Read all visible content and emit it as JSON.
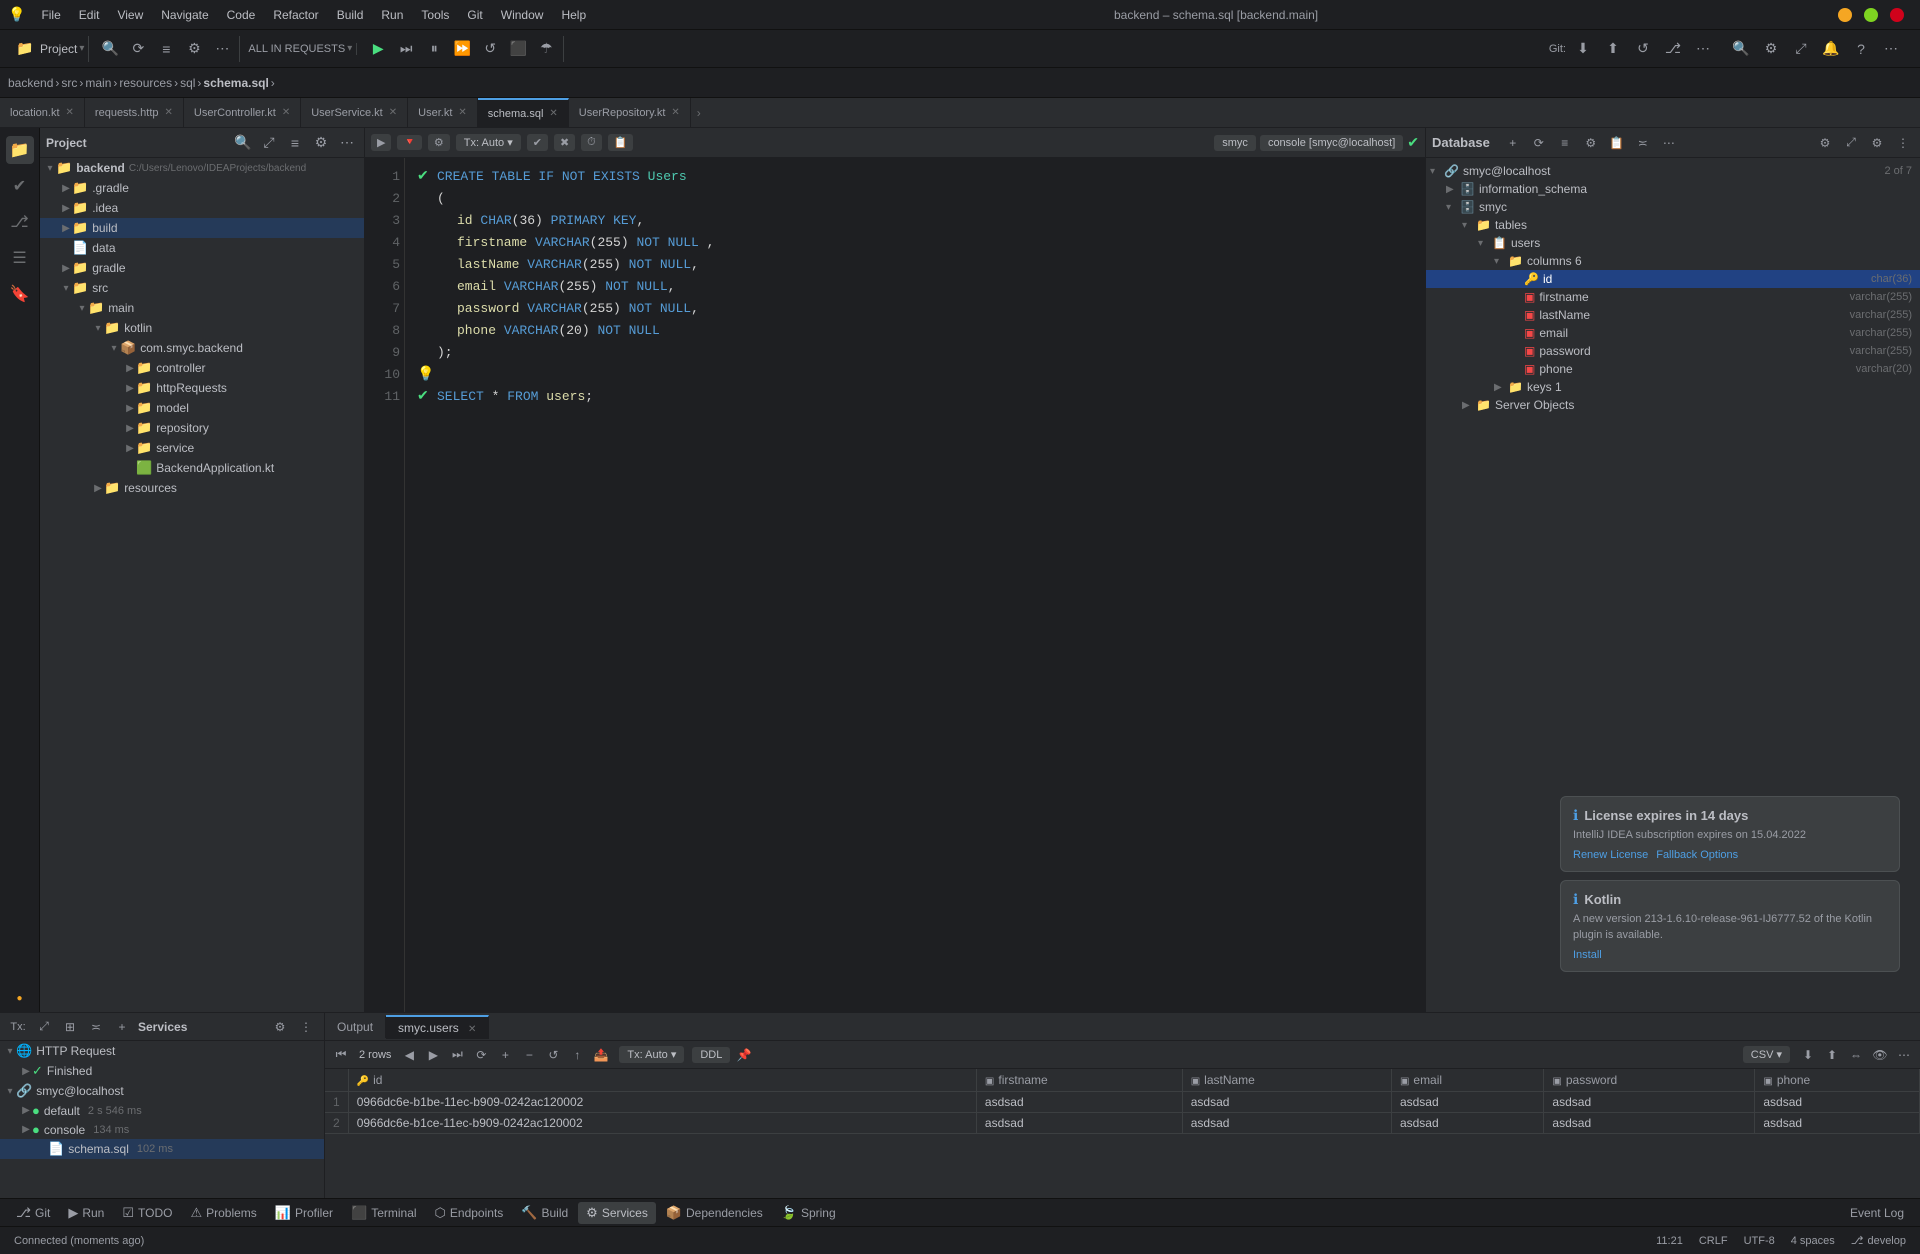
{
  "window": {
    "title": "backend – schema.sql [backend.main]",
    "icon": "💡"
  },
  "titlebar": {
    "menu_items": [
      "File",
      "Edit",
      "View",
      "Navigate",
      "Code",
      "Refactor",
      "Build",
      "Run",
      "Tools",
      "Git",
      "Window",
      "Help"
    ],
    "minimize": "—",
    "maximize": "❐",
    "close": "✕"
  },
  "breadcrumb": {
    "parts": [
      "backend",
      "src",
      "main",
      "resources",
      "sql",
      "schema.sql"
    ]
  },
  "tabs": [
    {
      "label": "location.kt",
      "active": false,
      "closable": true
    },
    {
      "label": "requests.http",
      "active": false,
      "closable": true
    },
    {
      "label": "UserController.kt",
      "active": false,
      "closable": true
    },
    {
      "label": "UserService.kt",
      "active": false,
      "closable": true
    },
    {
      "label": "User.kt",
      "active": false,
      "closable": true
    },
    {
      "label": "schema.sql",
      "active": true,
      "closable": true
    },
    {
      "label": "UserRepository.kt",
      "active": false,
      "closable": true
    }
  ],
  "editor": {
    "connection": "smyc",
    "console": "console [smyc@localhost]",
    "lines": [
      {
        "num": 1,
        "check": true,
        "run": true,
        "content": "CREATE TABLE IF NOT EXISTS Users"
      },
      {
        "num": 2,
        "content": "("
      },
      {
        "num": 3,
        "content": "    id   CHAR(36) PRIMARY KEY,"
      },
      {
        "num": 4,
        "content": "    firstname VARCHAR(255) NOT NULL ,"
      },
      {
        "num": 5,
        "content": "    lastName VARCHAR(255) NOT NULL,"
      },
      {
        "num": 6,
        "content": "    email VARCHAR(255) NOT NULL,"
      },
      {
        "num": 7,
        "content": "    password VARCHAR(255) NOT NULL,"
      },
      {
        "num": 8,
        "content": "    phone VARCHAR(20) NOT NULL"
      },
      {
        "num": 9,
        "content": ");"
      },
      {
        "num": 10,
        "content": ""
      },
      {
        "num": 11,
        "check": true,
        "run": true,
        "content": "SELECT * FROM users;"
      }
    ]
  },
  "sidebar": {
    "title": "Project",
    "root": "backend",
    "root_path": "C:/Users/Lenovo/IDEAProjects/backend",
    "items": [
      {
        "label": "gradle",
        "icon": "📁",
        "depth": 1,
        "expanded": false
      },
      {
        "label": ".idea",
        "icon": "📁",
        "depth": 1,
        "expanded": false
      },
      {
        "label": "build",
        "icon": "📁",
        "depth": 1,
        "expanded": false,
        "selected": true
      },
      {
        "label": "data",
        "icon": "📁",
        "depth": 1,
        "expanded": false
      },
      {
        "label": "gradle",
        "icon": "📁",
        "depth": 1,
        "expanded": false
      },
      {
        "label": "src",
        "icon": "📁",
        "depth": 1,
        "expanded": true
      },
      {
        "label": "main",
        "icon": "📁",
        "depth": 2,
        "expanded": true
      },
      {
        "label": "kotlin",
        "icon": "📁",
        "depth": 3,
        "expanded": true
      },
      {
        "label": "com.smyc.backend",
        "icon": "📦",
        "depth": 4,
        "expanded": true
      },
      {
        "label": "controller",
        "icon": "📁",
        "depth": 5,
        "expanded": false
      },
      {
        "label": "httpRequests",
        "icon": "📁",
        "depth": 5,
        "expanded": false
      },
      {
        "label": "model",
        "icon": "📁",
        "depth": 5,
        "expanded": false
      },
      {
        "label": "repository",
        "icon": "📁",
        "depth": 5,
        "expanded": false
      },
      {
        "label": "service",
        "icon": "📁",
        "depth": 5,
        "expanded": false
      },
      {
        "label": "BackendApplication.kt",
        "icon": "🟩",
        "depth": 5,
        "expanded": false
      },
      {
        "label": "resources",
        "icon": "📁",
        "depth": 3,
        "expanded": false
      }
    ]
  },
  "database": {
    "title": "Database",
    "connection": "smyc@localhost",
    "connection_label": "2 of 7",
    "items": [
      {
        "label": "smyc@localhost",
        "depth": 0,
        "expanded": true,
        "icon": "🔗"
      },
      {
        "label": "information_schema",
        "depth": 1,
        "expanded": false,
        "icon": "🗄️"
      },
      {
        "label": "smyc",
        "depth": 1,
        "expanded": true,
        "icon": "🗄️"
      },
      {
        "label": "tables",
        "depth": 2,
        "expanded": true,
        "icon": "📁"
      },
      {
        "label": "users",
        "depth": 3,
        "expanded": true,
        "icon": "📋"
      },
      {
        "label": "columns  6",
        "depth": 4,
        "expanded": true,
        "icon": "📁"
      },
      {
        "label": "id",
        "depth": 5,
        "expanded": false,
        "icon": "🔑",
        "type": "char(36)",
        "selected": true
      },
      {
        "label": "firstname",
        "depth": 5,
        "expanded": false,
        "icon": "🔤",
        "type": "varchar(255)"
      },
      {
        "label": "lastName",
        "depth": 5,
        "expanded": false,
        "icon": "🔤",
        "type": "varchar(255)"
      },
      {
        "label": "email",
        "depth": 5,
        "expanded": false,
        "icon": "🔤",
        "type": "varchar(255)"
      },
      {
        "label": "password",
        "depth": 5,
        "expanded": false,
        "icon": "🔤",
        "type": "varchar(255)"
      },
      {
        "label": "phone",
        "depth": 5,
        "expanded": false,
        "icon": "🔤",
        "type": "varchar(20)"
      },
      {
        "label": "keys  1",
        "depth": 4,
        "expanded": false,
        "icon": "📁"
      },
      {
        "label": "Server Objects",
        "depth": 1,
        "expanded": false,
        "icon": "📁"
      }
    ]
  },
  "services": {
    "title": "Services",
    "items": [
      {
        "label": "HTTP Request",
        "depth": 0,
        "expanded": true,
        "icon": "🌐"
      },
      {
        "label": "Finished",
        "depth": 1,
        "expanded": true,
        "icon": "✓"
      },
      {
        "label": "smyc@localhost",
        "depth": 0,
        "expanded": true,
        "icon": "🔗"
      },
      {
        "label": "default",
        "depth": 1,
        "expanded": false,
        "icon": "🟢",
        "info": "2 s 546 ms"
      },
      {
        "label": "console",
        "depth": 1,
        "expanded": false,
        "icon": "🟢",
        "info": "134 ms"
      },
      {
        "label": "schema.sql",
        "depth": 2,
        "expanded": false,
        "icon": "📄",
        "info": "102 ms",
        "selected": true
      }
    ]
  },
  "data_panel": {
    "tabs": [
      {
        "label": "Output",
        "active": false
      },
      {
        "label": "smyc.users",
        "active": true,
        "closable": true
      }
    ],
    "rows_count": "2 rows",
    "format": "CSV",
    "columns": [
      {
        "name": "id",
        "icon": "🔑"
      },
      {
        "name": "firstname",
        "icon": "🔤"
      },
      {
        "name": "lastName",
        "icon": "🔤"
      },
      {
        "name": "email",
        "icon": "🔤"
      },
      {
        "name": "password",
        "icon": "🔤"
      },
      {
        "name": "phone",
        "icon": "🔤"
      }
    ],
    "rows": [
      {
        "num": 1,
        "id": "0966dc6e-b1be-11ec-b909-0242ac120002",
        "firstname": "asdsad",
        "lastName": "asdsad",
        "email": "asdsad",
        "password": "asdsad",
        "phone": "asdsad"
      },
      {
        "num": 2,
        "id": "0966dc6e-b1ce-11ec-b909-0242ac120002",
        "firstname": "asdsad",
        "lastName": "asdsad",
        "email": "asdsad",
        "password": "asdsad",
        "phone": "asdsad"
      }
    ]
  },
  "notifications": [
    {
      "icon": "ℹ",
      "title": "License expires in 14 days",
      "body": "IntelliJ IDEA subscription expires on 15.04.2022",
      "actions": [
        "Renew License",
        "Fallback Options"
      ]
    },
    {
      "icon": "ℹ",
      "title": "Kotlin",
      "body": "A new version 213-1.6.10-release-961-IJ6777.52 of the Kotlin plugin is available.",
      "actions": [
        "Install"
      ]
    }
  ],
  "statusbar": {
    "left": "Connected (moments ago)",
    "time": "11:21",
    "encoding": "CRLF",
    "charset": "UTF-8",
    "indent": "4 spaces",
    "branch": "develop",
    "event_log": "Event Log"
  },
  "bottom_toolbar": {
    "items": [
      {
        "label": "Git",
        "icon": "⎇",
        "active": false
      },
      {
        "label": "Run",
        "icon": "▶",
        "active": false
      },
      {
        "label": "TODO",
        "icon": "☑",
        "active": false
      },
      {
        "label": "Problems",
        "icon": "⚠",
        "active": false
      },
      {
        "label": "Profiler",
        "icon": "📊",
        "active": false
      },
      {
        "label": "Terminal",
        "icon": "⬛",
        "active": false
      },
      {
        "label": "Endpoints",
        "icon": "⬡",
        "active": false
      },
      {
        "label": "Build",
        "icon": "🔨",
        "active": false
      },
      {
        "label": "Services",
        "icon": "⚙",
        "active": true
      },
      {
        "label": "Dependencies",
        "icon": "📦",
        "active": false
      },
      {
        "label": "Spring",
        "icon": "🍃",
        "active": false
      }
    ]
  }
}
